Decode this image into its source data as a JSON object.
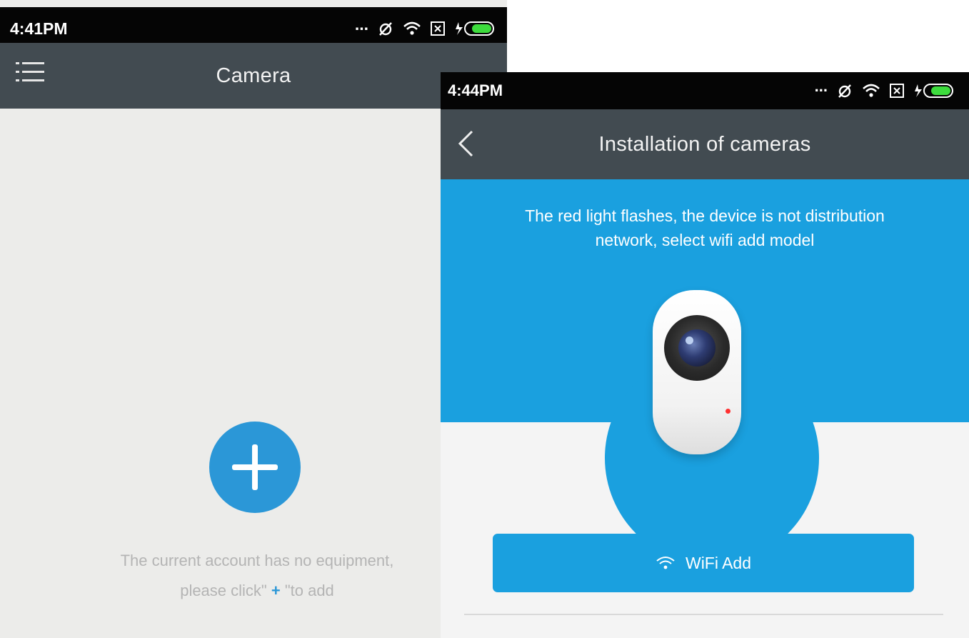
{
  "screen1": {
    "statusbar": {
      "time": "4:41PM",
      "dots": "..."
    },
    "appbar": {
      "title": "Camera"
    },
    "empty_state": {
      "line1": "The current account has no equipment,",
      "line2_prefix": "please click\"",
      "line2_plus": " + ",
      "line2_suffix": "\"to add"
    }
  },
  "screen2": {
    "statusbar": {
      "time": "4:44PM",
      "dots": "..."
    },
    "appbar": {
      "title": "Installation of cameras"
    },
    "hero": {
      "line1": "The red light flashes, the device is not distribution",
      "line2": "network, select wifi add model"
    },
    "wifi_button": {
      "label": "WiFi Add"
    }
  },
  "colors": {
    "accent": "#1aa0df",
    "appbar": "#424b51",
    "statusbar": "#050505",
    "background_light": "#ececea",
    "muted_text": "#b4b4b4",
    "battery": "#3ddc3d",
    "led": "#ff3030"
  }
}
